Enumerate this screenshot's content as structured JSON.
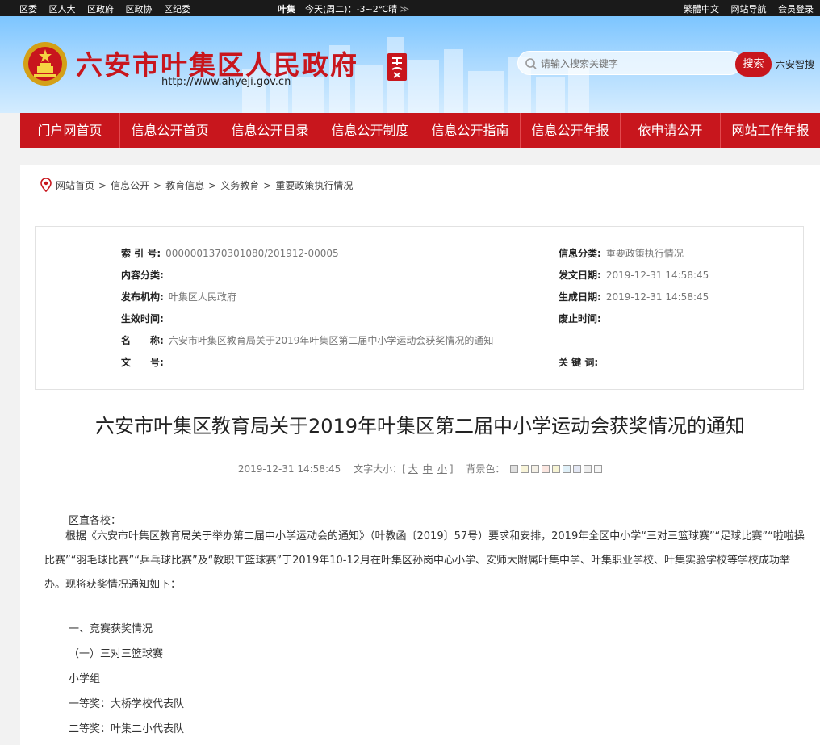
{
  "topbar": {
    "links": [
      "区委",
      "区人大",
      "区政府",
      "区政协",
      "区纪委"
    ],
    "weather_city": "叶集",
    "weather_text": "今天(周二)：-3~2℃晴",
    "weather_arrow": "≫",
    "right_links": [
      "繁體中文",
      "网站导航",
      "会员登录"
    ]
  },
  "header": {
    "title": "六安市叶集区人民政府",
    "url": "http://www.ahyeji.gov.cn",
    "search_placeholder": "请输入搜索关键字",
    "search_button": "搜索",
    "search_extra": "六安智搜"
  },
  "nav": {
    "items": [
      "门户网首页",
      "信息公开首页",
      "信息公开目录",
      "信息公开制度",
      "信息公开指南",
      "信息公开年报",
      "依申请公开",
      "网站工作年报"
    ]
  },
  "breadcrumb": {
    "items": [
      "网站首页",
      "信息公开",
      "教育信息",
      "义务教育",
      "重要政策执行情况"
    ],
    "separator": ">"
  },
  "info": {
    "index_label": "索 引 号:",
    "index_value": "0000001370301080/201912-00005",
    "category_label": "信息分类:",
    "category_value": "重要政策执行情况",
    "content_label": "内容分类:",
    "content_value": "",
    "issue_date_label": "发文日期:",
    "issue_date_value": "2019-12-31 14:58:45",
    "publisher_label": "发布机构:",
    "publisher_value": "叶集区人民政府",
    "created_label": "生成日期:",
    "created_value": "2019-12-31 14:58:45",
    "effective_label": "生效时间:",
    "effective_value": "",
    "expire_label": "废止时间:",
    "expire_value": "",
    "name_label": "名　　称:",
    "name_value": "六安市叶集区教育局关于2019年叶集区第二届中小学运动会获奖情况的通知",
    "docno_label": "文　　号:",
    "docno_value": "",
    "keywords_label": "关 键 词:",
    "keywords_value": ""
  },
  "article": {
    "title": "六安市叶集区教育局关于2019年叶集区第二届中小学运动会获奖情况的通知",
    "date": "2019-12-31 14:58:45",
    "font_size_label": "文字大小：[",
    "font_sizes": [
      "大",
      "中",
      "小"
    ],
    "font_size_close": "]",
    "bg_label": "背景色：",
    "bg_colors": [
      "#e0e0e0",
      "#f8f4d8",
      "#f4f0e6",
      "#fbe6e0",
      "#f7f4d4",
      "#e0f0f8",
      "#e4e8f4",
      "#eeeeee",
      "#f6f6f6"
    ],
    "paragraphs": [
      "区直各校：",
      "根据《六安市叶集区教育局关于举办第二届中小学运动会的通知》（叶教函〔2019〕57号）要求和安排，2019年全区中小学“三对三篮球赛”“足球比赛”“啦啦操比赛”“羽毛球比赛”“乒乓球比赛”及“教职工篮球赛”于2019年10-12月在叶集区孙岗中心小学、安师大附属叶集中学、叶集职业学校、叶集实验学校等学校成功举办。现将获奖情况通知如下：",
      "一、竞赛获奖情况",
      "（一）三对三篮球赛",
      "小学组",
      "一等奖：大桥学校代表队",
      "二等奖：叶集二小代表队"
    ]
  }
}
